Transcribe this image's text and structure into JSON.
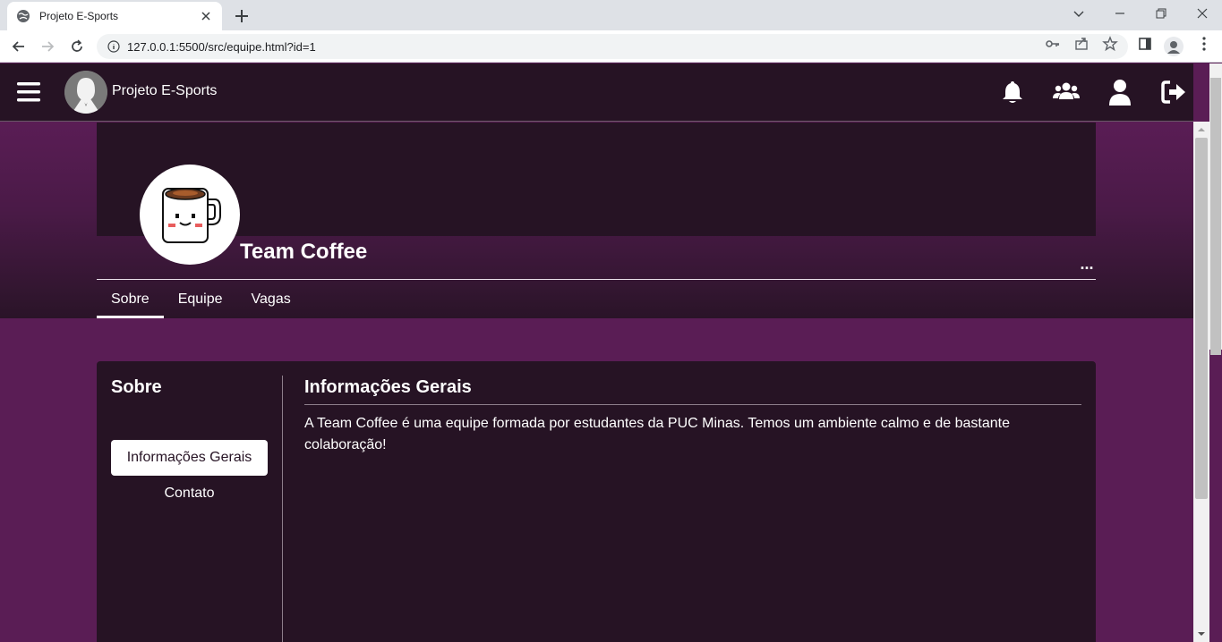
{
  "browser": {
    "tab_title": "Projeto E-Sports",
    "url": "127.0.0.1:5500/src/equipe.html?id=1"
  },
  "header": {
    "brand": "Projeto E-Sports",
    "icons": [
      "menu-icon",
      "bell-icon",
      "users-icon",
      "user-icon",
      "logout-icon"
    ]
  },
  "profile": {
    "team_name": "Team Coffee",
    "more": "...",
    "tabs": [
      {
        "label": "Sobre",
        "active": true
      },
      {
        "label": "Equipe",
        "active": false
      },
      {
        "label": "Vagas",
        "active": false
      }
    ]
  },
  "sidebar": {
    "title": "Sobre",
    "items": [
      {
        "label": "Informações Gerais",
        "active": true
      },
      {
        "label": "Contato",
        "active": false
      }
    ]
  },
  "content": {
    "title": "Informações Gerais",
    "text": "A Team Coffee é uma equipe formada por estudantes da PUC Minas. Temos um ambiente calmo e de bastante colaboração!"
  },
  "colors": {
    "page_bg": "#5a1d55",
    "panel": "#261324",
    "text": "#ffffff"
  }
}
